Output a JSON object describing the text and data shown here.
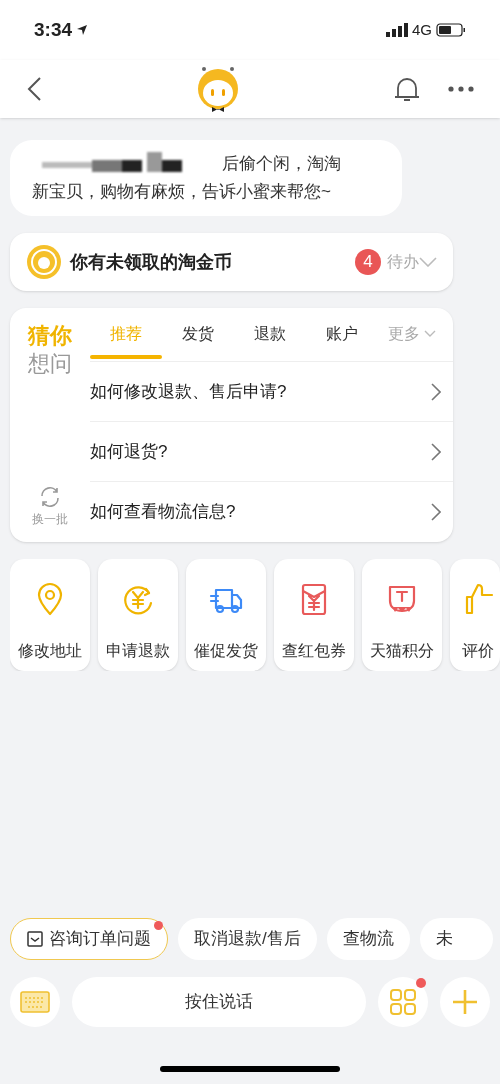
{
  "status_bar": {
    "time": "3:34",
    "network": "4G"
  },
  "chat_bubble": {
    "line_1": "后偷个闲，淘淘",
    "line_2": "新宝贝，购物有麻烦，告诉小蜜来帮您~"
  },
  "coin_card": {
    "text": "你有未领取的淘金币",
    "badge": "4",
    "todo": "待办"
  },
  "guess_card": {
    "title_1": "猜你",
    "title_2": "想问",
    "refresh": "换一批",
    "tabs": [
      {
        "label": "推荐",
        "selected": true
      },
      {
        "label": "发货",
        "selected": false
      },
      {
        "label": "退款",
        "selected": false
      },
      {
        "label": "账户",
        "selected": false
      }
    ],
    "more": "更多",
    "questions": [
      "如何修改退款、售后申请?",
      "如何退货?",
      "如何查看物流信息?"
    ]
  },
  "actions": [
    {
      "label": "修改地址",
      "kind": "pin",
      "color": "#f0b400"
    },
    {
      "label": "申请退款",
      "kind": "yen",
      "color": "#f0b400"
    },
    {
      "label": "催促发货",
      "kind": "truck",
      "color": "#3d8af7"
    },
    {
      "label": "查红包券",
      "kind": "envelope",
      "color": "#e85a5a"
    },
    {
      "label": "天猫积分",
      "kind": "tmall",
      "color": "#e85a5a"
    },
    {
      "label": "评价",
      "kind": "thumb",
      "color": "#f0b400"
    }
  ],
  "chips": [
    {
      "label": "咨询订单问题",
      "selected": true,
      "dot": true
    },
    {
      "label": "取消退款/售后",
      "selected": false,
      "dot": false
    },
    {
      "label": "查物流",
      "selected": false,
      "dot": false
    },
    {
      "label": "未",
      "selected": false,
      "dot": false
    }
  ],
  "input_bar": {
    "voice": "按住说话",
    "apps_dot": true
  }
}
